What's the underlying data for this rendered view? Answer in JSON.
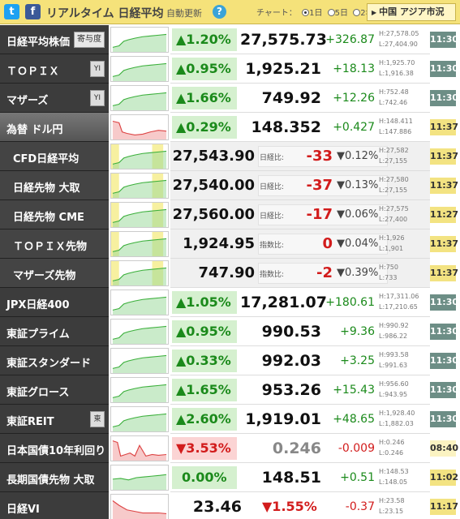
{
  "header": {
    "twitter_glyph": "t",
    "facebook_glyph": "f",
    "brand": "リアルタイム 日経平均",
    "auto_update": "自動更新",
    "help": "?",
    "chart_label": "チャート：",
    "chart_options": [
      "1日",
      "5日",
      "2年"
    ],
    "chart_selected": "1日",
    "market_button": "中国 アジア市況"
  },
  "colors": {
    "up": "#1b8a1b",
    "down": "#d21c1c",
    "header": "#f5e27a",
    "name_bg": "#3c3c3c"
  },
  "rows": [
    {
      "name": "日経平均株価",
      "tag": "寄与度",
      "pct": "▲1.20%",
      "price": "27,575.73",
      "chg": "+326.87",
      "high": "H:27,578.05",
      "low": "L:27,404.90",
      "time": "11:30"
    },
    {
      "name": "ＴＯＰＩＸ",
      "tag": "YI",
      "pct": "▲0.95%",
      "price": "1,925.21",
      "chg": "+18.13",
      "high": "H:1,925.70",
      "low": "L:1,916.38",
      "time": "11:30"
    },
    {
      "name": "マザーズ",
      "tag": "YI",
      "pct": "▲1.66%",
      "price": "749.92",
      "chg": "+12.26",
      "high": "H:752.48",
      "low": "L:742.46",
      "time": "11:30"
    },
    {
      "name": "為替 ドル円",
      "pct": "▲0.29%",
      "price": "148.352",
      "chg": "+0.427",
      "high": "H:148.411",
      "low": "L:147.886",
      "time": "11:37"
    },
    {
      "name": "CFD日経平均",
      "price": "27,543.90",
      "label": "日経比:",
      "diff": "-33",
      "pct": "▼0.12%",
      "high": "H:27,582",
      "low": "L:27,155",
      "time": "11:37"
    },
    {
      "name": "日経先物 大取",
      "price": "27,540.00",
      "label": "日経比:",
      "diff": "-37",
      "pct": "▼0.13%",
      "high": "H:27,580",
      "low": "L:27,155",
      "time": "11:37"
    },
    {
      "name": "日経先物 CME",
      "price": "27,560.00",
      "label": "日経比:",
      "diff": "-17",
      "pct": "▼0.06%",
      "high": "H:27,575",
      "low": "L:27,400",
      "time": "11:27"
    },
    {
      "name": "ＴＯＰＩＸ先物",
      "price": "1,924.95",
      "label": "指数比:",
      "diff": "0",
      "pct": "▼0.04%",
      "high": "H:1,926",
      "low": "L:1,901",
      "time": "11:37"
    },
    {
      "name": "マザーズ先物",
      "price": "747.90",
      "label": "指数比:",
      "diff": "-2",
      "pct": "▼0.39%",
      "high": "H:750",
      "low": "L:733",
      "time": "11:37"
    },
    {
      "name": "JPX日経400",
      "pct": "▲1.05%",
      "price": "17,281.07",
      "chg": "+180.61",
      "high": "H:17,311.06",
      "low": "L:17,210.65",
      "time": "11:30"
    },
    {
      "name": "東証プライム",
      "pct": "▲0.95%",
      "price": "990.53",
      "chg": "+9.36",
      "high": "H:990.92",
      "low": "L:986.22",
      "time": "11:30"
    },
    {
      "name": "東証スタンダード",
      "pct": "▲0.33%",
      "price": "992.03",
      "chg": "+3.25",
      "high": "H:993.58",
      "low": "L:991.63",
      "time": "11:30"
    },
    {
      "name": "東証グロース",
      "pct": "▲1.65%",
      "price": "953.26",
      "chg": "+15.43",
      "high": "H:956.60",
      "low": "L:943.95",
      "time": "11:30"
    },
    {
      "name": "東証REIT",
      "tag": "東",
      "pct": "▲2.60%",
      "price": "1,919.01",
      "chg": "+48.65",
      "high": "H:1,928.40",
      "low": "L:1,882.03",
      "time": "11:30"
    },
    {
      "name": "日本国債10年利回り",
      "pct": "▼3.53%",
      "price": "0.246",
      "chg": "-0.009",
      "high": "H:0.246",
      "low": "L:0.246",
      "time": "08:40"
    },
    {
      "name": "長期国債先物 大取",
      "pct": "0.00%",
      "price": "148.51",
      "chg": "+0.51",
      "high": "H:148.53",
      "low": "L:148.05",
      "time": "11:02"
    },
    {
      "name": "日経VI",
      "price": "23.46",
      "pct": "▼1.55%",
      "chg": "-0.37",
      "high": "H:23.58",
      "low": "L:23.15",
      "time": "11:17"
    }
  ]
}
